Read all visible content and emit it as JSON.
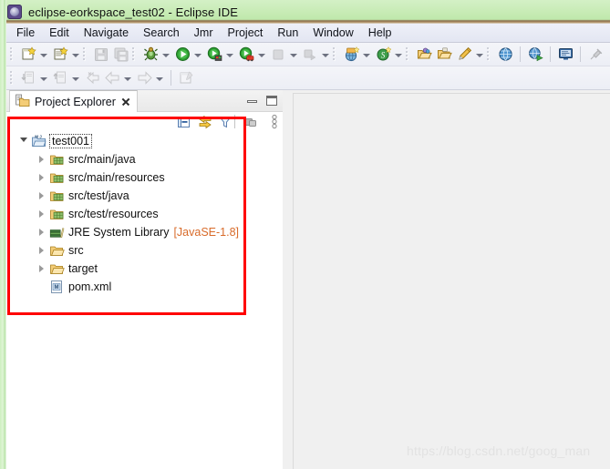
{
  "window": {
    "title": "eclipse-eorkspace_test02 - Eclipse IDE",
    "app_icon": "eclipse-icon"
  },
  "menubar": {
    "items": [
      {
        "label": "File",
        "name": "menu-file"
      },
      {
        "label": "Edit",
        "name": "menu-edit"
      },
      {
        "label": "Navigate",
        "name": "menu-navigate"
      },
      {
        "label": "Search",
        "name": "menu-search"
      },
      {
        "label": "Jmr",
        "name": "menu-jmr"
      },
      {
        "label": "Project",
        "name": "menu-project"
      },
      {
        "label": "Run",
        "name": "menu-run"
      },
      {
        "label": "Window",
        "name": "menu-window"
      },
      {
        "label": "Help",
        "name": "menu-help"
      }
    ]
  },
  "toolbar_row1": {
    "buttons": [
      {
        "name": "new-wizard-button",
        "icon": "new-file-icon"
      },
      {
        "name": "new-wizard-dropdown",
        "icon": "chevron-down-icon"
      },
      {
        "name": "new-java-class-button",
        "icon": "new-class-icon"
      },
      {
        "name": "new-java-class-dropdown",
        "icon": "chevron-down-icon"
      },
      {
        "name": "save-button",
        "icon": "save-disk-icon"
      },
      {
        "name": "save-all-button",
        "icon": "save-all-icon"
      },
      {
        "name": "debug-button",
        "icon": "debug-bug-icon"
      },
      {
        "name": "debug-dropdown",
        "icon": "chevron-down-icon"
      },
      {
        "name": "run-button",
        "icon": "run-play-icon"
      },
      {
        "name": "run-dropdown",
        "icon": "chevron-down-icon"
      },
      {
        "name": "run-as-server-button",
        "icon": "run-server-icon"
      },
      {
        "name": "run-as-server-dropdown",
        "icon": "chevron-down-icon"
      },
      {
        "name": "run-coverage-button",
        "icon": "coverage-icon"
      },
      {
        "name": "run-coverage-dropdown",
        "icon": "chevron-down-icon"
      },
      {
        "name": "terminate-button",
        "icon": "stop-square-icon"
      },
      {
        "name": "terminate-dropdown",
        "icon": "chevron-down-icon"
      },
      {
        "name": "skip-breakpoints-button",
        "icon": "skip-breakpoints-icon"
      },
      {
        "name": "skip-breakpoints-dropdown",
        "icon": "chevron-down-icon"
      },
      {
        "name": "new-web-project-button",
        "icon": "new-web-project-icon"
      },
      {
        "name": "new-web-project-dropdown",
        "icon": "chevron-down-icon"
      },
      {
        "name": "new-spring-element-button",
        "icon": "spring-icon"
      },
      {
        "name": "new-spring-element-dropdown",
        "icon": "chevron-down-icon"
      },
      {
        "name": "open-type-button",
        "icon": "open-type-icon"
      },
      {
        "name": "open-task-button",
        "icon": "open-task-icon"
      },
      {
        "name": "external-tools-button",
        "icon": "external-tools-icon"
      },
      {
        "name": "external-tools-dropdown",
        "icon": "chevron-down-icon"
      },
      {
        "name": "open-browser-button",
        "icon": "globe-icon"
      },
      {
        "name": "run-web-app-button",
        "icon": "globe-run-icon"
      },
      {
        "name": "open-console-button",
        "icon": "console-icon"
      },
      {
        "name": "pin-console-button",
        "icon": "pin-icon"
      }
    ]
  },
  "toolbar_row2": {
    "buttons": [
      {
        "name": "next-annotation-button",
        "icon": "next-annotation-icon"
      },
      {
        "name": "next-annotation-dropdown",
        "icon": "chevron-down-icon"
      },
      {
        "name": "previous-annotation-button",
        "icon": "previous-annotation-icon"
      },
      {
        "name": "previous-annotation-dropdown",
        "icon": "chevron-down-icon"
      },
      {
        "name": "last-edit-location-button",
        "icon": "last-edit-location-icon"
      },
      {
        "name": "back-button",
        "icon": "back-arrow-icon"
      },
      {
        "name": "back-dropdown",
        "icon": "chevron-down-icon"
      },
      {
        "name": "forward-button",
        "icon": "forward-arrow-icon"
      },
      {
        "name": "forward-dropdown",
        "icon": "chevron-down-icon"
      },
      {
        "name": "new-editor-button",
        "icon": "new-editor-icon"
      }
    ]
  },
  "project_explorer": {
    "tab_label": "Project Explorer",
    "tab_icon": "project-explorer-icon",
    "close_icon": "close-icon",
    "minimize_icon": "minimize-icon",
    "maximize_icon": "maximize-icon",
    "view_toolbar": [
      {
        "name": "collapse-all-button",
        "icon": "collapse-all-icon"
      },
      {
        "name": "link-with-editor-button",
        "icon": "link-with-editor-icon"
      },
      {
        "name": "focus-on-active-task-button",
        "icon": "filter-icon"
      },
      {
        "name": "view-menu-button",
        "icon": "view-menu-icon"
      }
    ],
    "tree": [
      {
        "label": "test001",
        "icon": "maven-java-project-icon",
        "indent": 0,
        "twisty": "open",
        "selected": true,
        "sub": ""
      },
      {
        "label": "src/main/java",
        "icon": "source-folder-icon",
        "indent": 1,
        "twisty": "closed",
        "selected": false,
        "sub": ""
      },
      {
        "label": "src/main/resources",
        "icon": "source-folder-icon",
        "indent": 1,
        "twisty": "closed",
        "selected": false,
        "sub": ""
      },
      {
        "label": "src/test/java",
        "icon": "source-folder-icon",
        "indent": 1,
        "twisty": "closed",
        "selected": false,
        "sub": ""
      },
      {
        "label": "src/test/resources",
        "icon": "source-folder-icon",
        "indent": 1,
        "twisty": "closed",
        "selected": false,
        "sub": ""
      },
      {
        "label": "JRE System Library",
        "icon": "jre-library-icon",
        "indent": 1,
        "twisty": "closed",
        "selected": false,
        "sub": "[JavaSE-1.8]"
      },
      {
        "label": "src",
        "icon": "folder-icon",
        "indent": 1,
        "twisty": "closed",
        "selected": false,
        "sub": ""
      },
      {
        "label": "target",
        "icon": "folder-icon",
        "indent": 1,
        "twisty": "closed",
        "selected": false,
        "sub": ""
      },
      {
        "label": "pom.xml",
        "icon": "maven-pom-icon",
        "indent": 1,
        "twisty": "none",
        "selected": false,
        "sub": ""
      }
    ]
  },
  "annotation": {
    "name": "red-highlight-rectangle",
    "color": "#ff0000"
  },
  "watermark": {
    "text": "https://blog.csdn.net/goog_man",
    "color": "#e2e2e2"
  },
  "colors": {
    "titlebar_green": "#c6ebb4",
    "menubar": "#e3e6f2",
    "toolbar": "#eceef5",
    "tree_bg": "#ffffff",
    "editor_bg": "#f0f0f0",
    "jre_variant_text": "#d86b2a",
    "annotation_red": "#ff0000"
  }
}
